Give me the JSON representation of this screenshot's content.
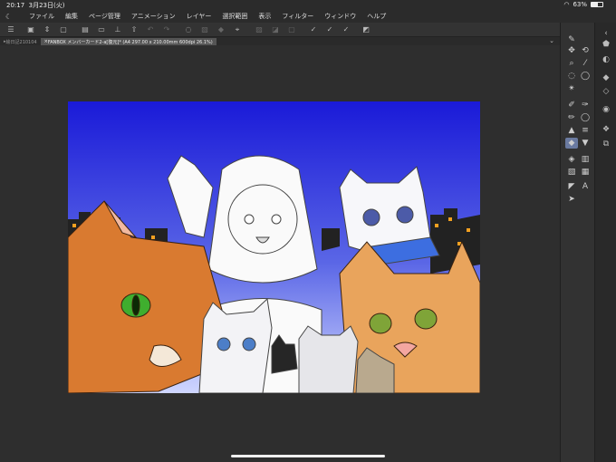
{
  "status_bar": {
    "time": "20:17",
    "date": "3月23日(火)",
    "battery": "63%",
    "battery_level": 0.63
  },
  "menu": {
    "items": [
      "ファイル",
      "編集",
      "ページ管理",
      "アニメーション",
      "レイヤー",
      "選択範囲",
      "表示",
      "フィルター",
      "ウィンドウ",
      "ヘルプ"
    ]
  },
  "tabs": {
    "inactive": "絵日記210104",
    "active": "FANBOX メンバーカード2-a[復元]* (A4 297.00 x 210.00mm 600dpi 26.1%)"
  },
  "colors": {
    "sky_top": "#1a1ad8",
    "sky_bottom": "#cfd6ff",
    "selected_tool": "#6a7aa0"
  },
  "toolbar_icons": [
    "hamburger-icon",
    "new-icon",
    "stepper-icon",
    "companion-icon",
    "page-icon",
    "open-icon",
    "save-icon",
    "upload-icon",
    "undo-icon",
    "redo-icon",
    "clear-icon",
    "crop-icon",
    "fill-icon",
    "transform-icon",
    "select-icon",
    "deselect-icon",
    "invert-icon",
    "expand-icon",
    "pen-1-icon",
    "pen-2-icon",
    "pen-3-icon",
    "edit-icon"
  ],
  "tool_icons": [
    "pen-select-icon",
    "move-icon",
    "rotate-icon",
    "zoom-icon",
    "eyedropper-icon",
    "lasso-icon",
    "lasso-2-icon",
    "wand-icon",
    "brush-icon",
    "pen-icon",
    "pencil-icon",
    "blend-icon",
    "fill-icon",
    "eraser-icon",
    "bucket-icon",
    "gradient-icon",
    "bucket-2-icon",
    "frame-icon",
    "ruler-icon",
    "text-icon",
    "cursor-icon"
  ],
  "side_icons": [
    "collapse-icon",
    "color-wheel-icon",
    "color-fill-icon",
    "bucket-side-icon",
    "layer-stack-icon",
    "material-icon",
    "navigator-icon"
  ]
}
